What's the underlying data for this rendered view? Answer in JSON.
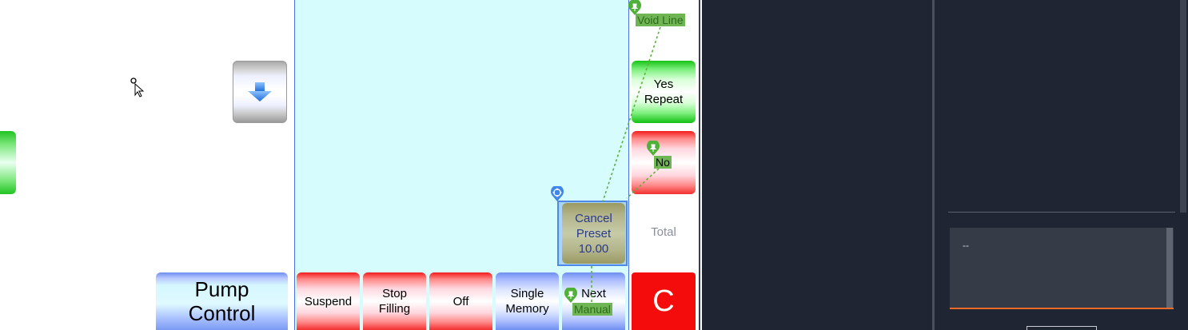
{
  "left": {
    "pump_button": {
      "line1": "Pump",
      "line2": "Control"
    }
  },
  "bottom_buttons": {
    "suspend": "Suspend",
    "stop_line1": "Stop",
    "stop_line2": "Filling",
    "off": "Off",
    "single_line1": "Single",
    "single_line2": "Memory",
    "next": "Next"
  },
  "right_column": {
    "yes_line1": "Yes",
    "yes_line2": "Repeat",
    "total": "Total",
    "c": "C"
  },
  "selection": {
    "cancel_line1": "Cancel",
    "cancel_line2": "Preset",
    "cancel_value": "10.00"
  },
  "annotations": {
    "void_line": "Void Line",
    "no": "No",
    "manual": "Manual"
  },
  "console": {
    "text": "--"
  },
  "colors": {
    "panel_cyan": "#d7fcfe",
    "dark_bg": "#1f2532",
    "accent_orange": "#ee6b25",
    "annotation_green": "#6fb553",
    "selection_blue": "#4f89e6",
    "c_red": "#f40b0b"
  }
}
